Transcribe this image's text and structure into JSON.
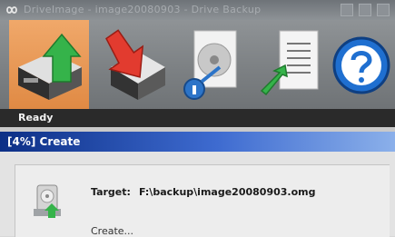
{
  "window": {
    "title": "DriveImage - image20080903 - Drive Backup",
    "app_icon": "infinity-logo-icon",
    "controls": [
      "minimize-icon",
      "maximize-icon",
      "close-icon"
    ]
  },
  "toolbar": {
    "buttons": [
      {
        "name": "backup",
        "icon": "backup-drive-up-arrow-icon",
        "active": true
      },
      {
        "name": "restore",
        "icon": "restore-drive-down-arrow-icon",
        "active": false
      },
      {
        "name": "disc",
        "icon": "cd-disc-search-icon",
        "active": false
      },
      {
        "name": "log",
        "icon": "document-arrow-icon",
        "active": false
      },
      {
        "name": "help",
        "icon": "help-question-icon",
        "active": false
      }
    ],
    "active_color": "#e8944f"
  },
  "status": {
    "text": "Ready"
  },
  "dialog": {
    "title": "[4%] Create",
    "target_label": "Target:",
    "target_path": "F:\\backup\\image20080903.omg",
    "status_line": "Create...",
    "icon": "disk-drive-icon"
  }
}
